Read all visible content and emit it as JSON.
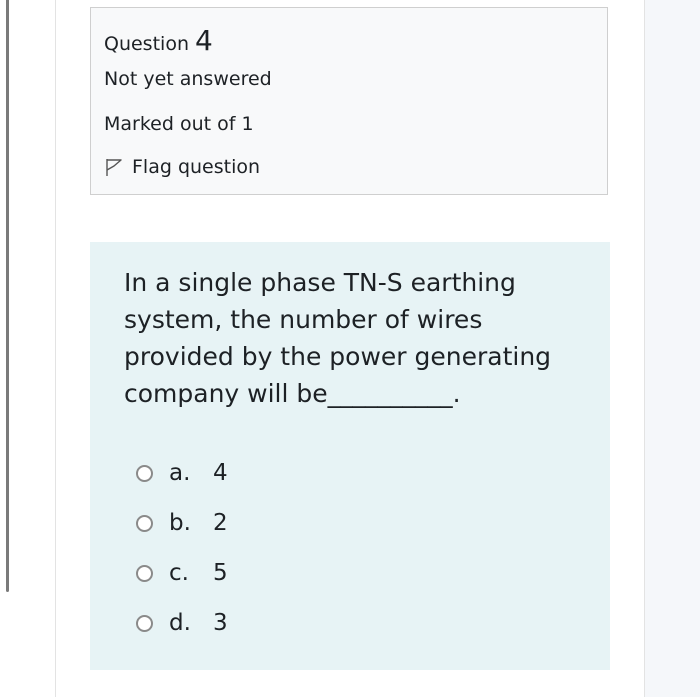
{
  "info": {
    "question_label": "Question",
    "question_number": "4",
    "state": "Not yet answered",
    "grade": "Marked out of 1",
    "flag_label": "Flag question"
  },
  "question": {
    "text": "In a single phase TN-S earthing system, the number of wires provided by the power generating company will be__________."
  },
  "answers": [
    {
      "letter": "a.",
      "value": "4"
    },
    {
      "letter": "b.",
      "value": "2"
    },
    {
      "letter": "c.",
      "value": "5"
    },
    {
      "letter": "d.",
      "value": "3"
    }
  ],
  "icons": {
    "flag": "flag-icon"
  },
  "colors": {
    "info_background": "#f8f9fa",
    "content_background": "#e7f3f5",
    "text": "#1d2125"
  }
}
